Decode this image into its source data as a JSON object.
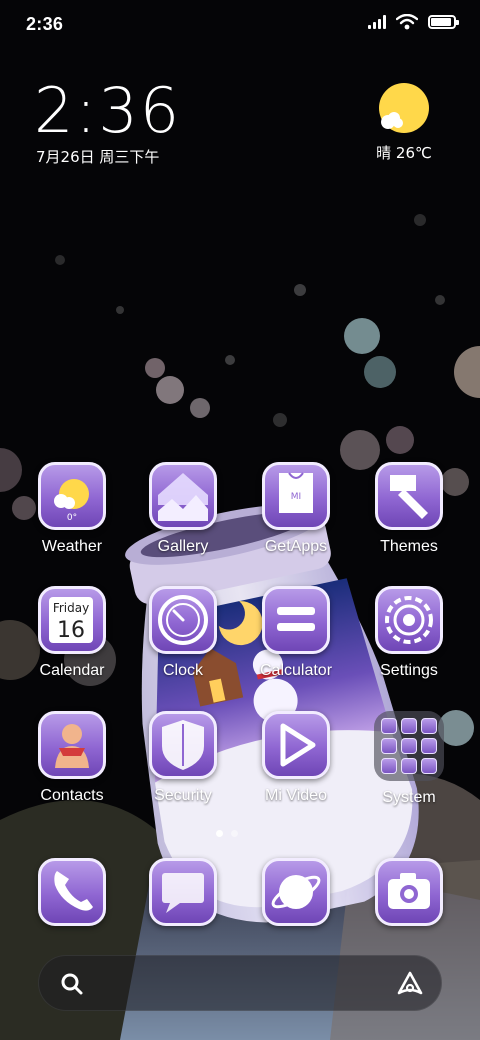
{
  "status_bar": {
    "time": "2:36",
    "icons": [
      "signal-icon",
      "wifi-icon",
      "battery-icon"
    ],
    "battery_level": 0.9
  },
  "clock_widget": {
    "time": "2:36",
    "date": "7月26日 周三下午"
  },
  "weather_widget": {
    "icon": "sun-cloud-icon",
    "text": "晴 26℃"
  },
  "apps": [
    {
      "label": "Weather",
      "icon": "weather-icon",
      "badge": "0°"
    },
    {
      "label": "Gallery",
      "icon": "gallery-icon"
    },
    {
      "label": "GetApps",
      "icon": "getapps-icon",
      "badge": "MI"
    },
    {
      "label": "Themes",
      "icon": "themes-brush-icon"
    },
    {
      "label": "Calendar",
      "icon": "calendar-icon",
      "day_name": "Friday",
      "day_number": "16"
    },
    {
      "label": "Clock",
      "icon": "clock-icon"
    },
    {
      "label": "Calculator",
      "icon": "calculator-icon"
    },
    {
      "label": "Settings",
      "icon": "settings-gear-icon"
    },
    {
      "label": "Contacts",
      "icon": "contacts-icon"
    },
    {
      "label": "Security",
      "icon": "security-shield-icon"
    },
    {
      "label": "Mi Video",
      "icon": "video-play-icon"
    },
    {
      "label": "System",
      "icon": "folder-icon"
    }
  ],
  "dock": [
    {
      "icon": "phone-icon"
    },
    {
      "icon": "messages-icon"
    },
    {
      "icon": "browser-icon"
    },
    {
      "icon": "camera-icon"
    }
  ],
  "pager": {
    "pages": 2,
    "current": 1
  },
  "search_bar": {
    "left_icon": "search-icon",
    "right_icon": "assistant-icon"
  },
  "colors": {
    "icon_purple": "#8f66d2",
    "icon_border": "#f2ecff",
    "sun_yellow": "#ffd84a",
    "background": "#050507"
  }
}
